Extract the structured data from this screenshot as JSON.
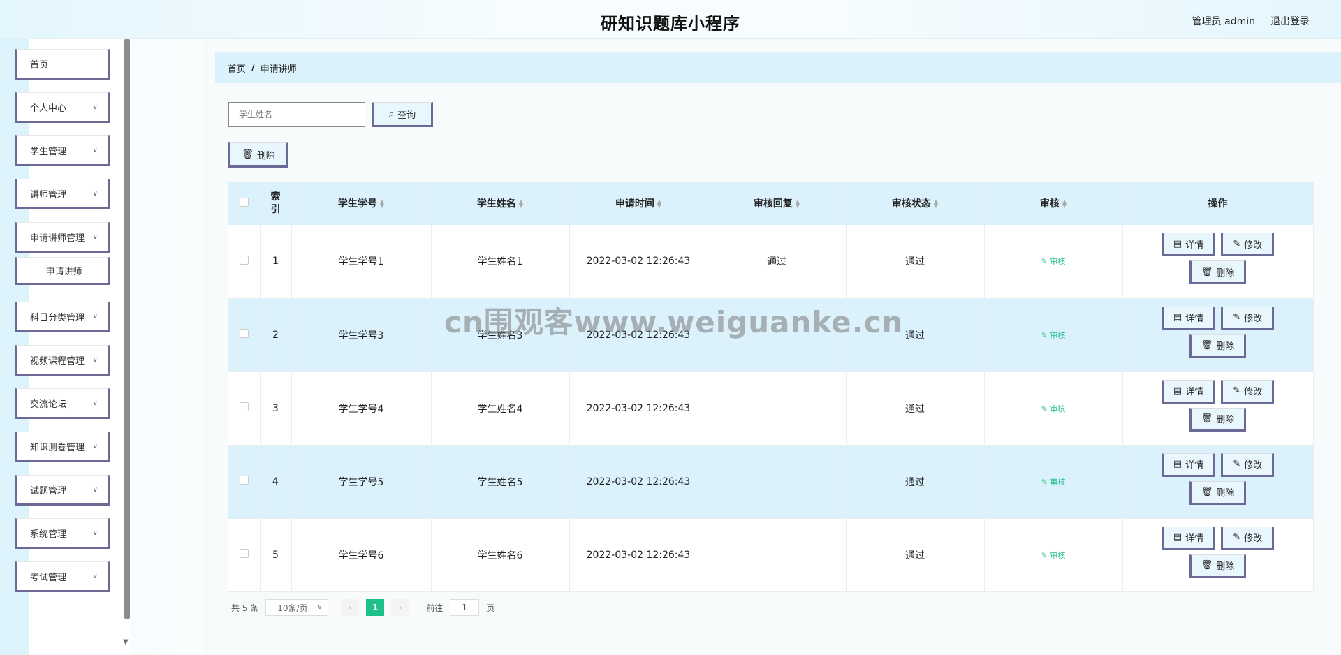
{
  "header": {
    "title": "研知识题库小程序",
    "user_label": "管理员 admin",
    "logout_label": "退出登录"
  },
  "sidebar": {
    "items": [
      {
        "label": "首页",
        "has_children": false
      },
      {
        "label": "个人中心",
        "has_children": true
      },
      {
        "label": "学生管理",
        "has_children": true
      },
      {
        "label": "讲师管理",
        "has_children": true
      },
      {
        "label": "申请讲师管理",
        "has_children": true
      },
      {
        "label": "申请讲师",
        "has_children": false,
        "sub": true
      },
      {
        "label": "科目分类管理",
        "has_children": true
      },
      {
        "label": "视频课程管理",
        "has_children": true
      },
      {
        "label": "交流论坛",
        "has_children": true
      },
      {
        "label": "知识测卷管理",
        "has_children": true
      },
      {
        "label": "试题管理",
        "has_children": true
      },
      {
        "label": "系统管理",
        "has_children": true
      },
      {
        "label": "考试管理",
        "has_children": true
      }
    ]
  },
  "breadcrumb": {
    "home": "首页",
    "separator": "/",
    "current": "申请讲师"
  },
  "search": {
    "placeholder": "学生姓名",
    "query_label": "查询",
    "delete_label": "删除"
  },
  "table": {
    "headers": [
      "索引",
      "学生学号",
      "学生姓名",
      "申请时间",
      "审核回复",
      "审核状态",
      "审核",
      "操作"
    ],
    "rows": [
      {
        "index": "1",
        "student_no": "学生学号1",
        "student_name": "学生姓名1",
        "apply_time": "2022-03-02 12:26:43",
        "reply": "通过",
        "status": "通过"
      },
      {
        "index": "2",
        "student_no": "学生学号3",
        "student_name": "学生姓名3",
        "apply_time": "2022-03-02 12:26:43",
        "reply": "",
        "status": "通过"
      },
      {
        "index": "3",
        "student_no": "学生学号4",
        "student_name": "学生姓名4",
        "apply_time": "2022-03-02 12:26:43",
        "reply": "",
        "status": "通过"
      },
      {
        "index": "4",
        "student_no": "学生学号5",
        "student_name": "学生姓名5",
        "apply_time": "2022-03-02 12:26:43",
        "reply": "",
        "status": "通过"
      },
      {
        "index": "5",
        "student_no": "学生学号6",
        "student_name": "学生姓名6",
        "apply_time": "2022-03-02 12:26:43",
        "reply": "",
        "status": "通过"
      }
    ],
    "audit_label": "审核",
    "detail_label": "详情",
    "edit_label": "修改",
    "delete_label": "删除"
  },
  "pagination": {
    "total_text": "共 5 条",
    "page_size": "10条/页",
    "current_page": "1",
    "goto_prefix": "前往",
    "goto_value": "1",
    "goto_suffix": "页"
  },
  "watermark": "cn围观客www.weiguanke.cn",
  "colors": {
    "accent_green": "#1ec08a",
    "header_bg": "#dbf2fd",
    "border_accent": "#6b6995"
  }
}
